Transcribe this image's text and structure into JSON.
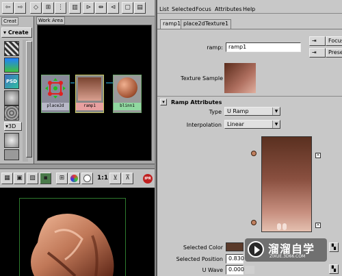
{
  "left_panel": {
    "tab_label": "Creat",
    "create_label": "Create",
    "swatch_psd": "PSD",
    "swatch_3d": "3D"
  },
  "work_area": {
    "tab_label": "Work Area"
  },
  "nodes": {
    "place2d": "place2d",
    "ramp": "ramp1",
    "blinn": "blinn1"
  },
  "render_toolbar": {
    "ratio": "1:1",
    "ipr": "IPR"
  },
  "attr_editor": {
    "menu": [
      "List",
      "Selected",
      "Focus",
      "Attributes",
      "Help"
    ],
    "tabs": [
      "ramp1",
      "place2dTexture1"
    ],
    "ramp_label": "ramp:",
    "ramp_value": "ramp1",
    "focus_btn": "Focus",
    "presets_btn": "Presets",
    "texture_sample_label": "Texture Sample",
    "section_title": "Ramp Attributes",
    "type_label": "Type",
    "type_value": "U Ramp",
    "interp_label": "Interpolation",
    "interp_value": "Linear",
    "selected_color_label": "Selected Color",
    "selected_position_label": "Selected Position",
    "selected_position_value": "0.830",
    "u_wave_label": "U Wave",
    "u_wave_value": "0.000"
  },
  "watermark": {
    "title": "溜溜自学",
    "url": "ZIXUE.3D66.COM"
  },
  "colors": {
    "ramp_top": "#5a3020",
    "ramp_bottom": "#e0b0a0",
    "selected_color": "#5a3a2a",
    "sphere": "#d08060"
  }
}
